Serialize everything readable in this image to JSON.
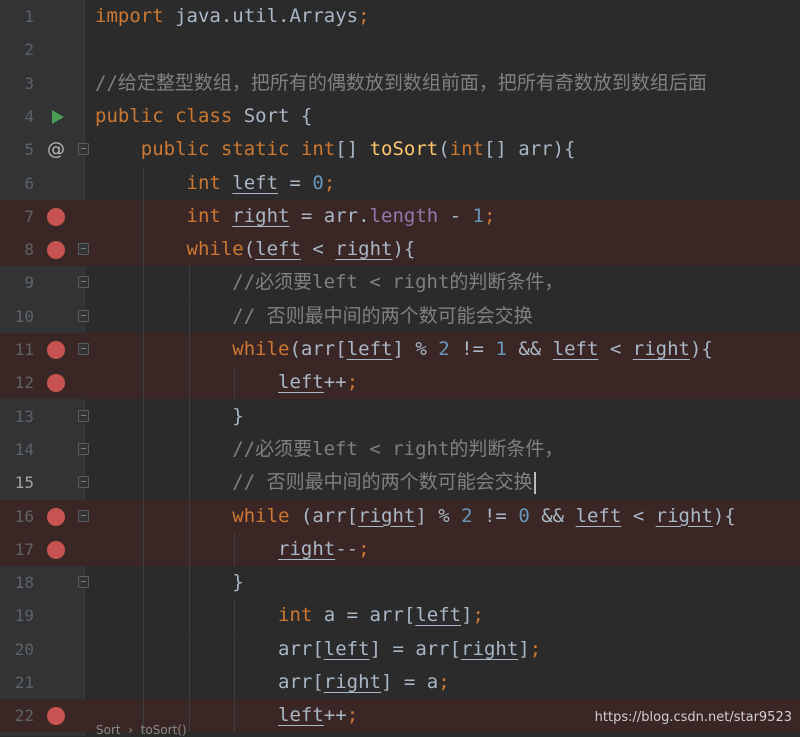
{
  "editor": {
    "lines": [
      {
        "num": "1",
        "marker": "",
        "fold": "",
        "bp_row": false,
        "current": false,
        "indent": 0,
        "tokens": [
          {
            "t": "import",
            "c": "kw"
          },
          {
            "t": " java.util.Arrays",
            "c": ""
          },
          {
            "t": ";",
            "c": "kw"
          }
        ]
      },
      {
        "num": "2",
        "marker": "",
        "fold": "",
        "bp_row": false,
        "current": false,
        "indent": 0,
        "tokens": []
      },
      {
        "num": "3",
        "marker": "",
        "fold": "",
        "bp_row": false,
        "current": false,
        "indent": 0,
        "tokens": [
          {
            "t": "//给定整型数组，把所有的偶数放到数组前面，把所有奇数放到数组后面",
            "c": "cm"
          }
        ]
      },
      {
        "num": "4",
        "marker": "run",
        "fold": "",
        "bp_row": false,
        "current": false,
        "indent": 0,
        "tokens": [
          {
            "t": "public class ",
            "c": "kw"
          },
          {
            "t": "Sort {",
            "c": ""
          }
        ]
      },
      {
        "num": "5",
        "marker": "at",
        "fold": "open",
        "bp_row": false,
        "current": false,
        "indent": 1,
        "tokens": [
          {
            "t": "public static int",
            "c": "kw"
          },
          {
            "t": "[] ",
            "c": ""
          },
          {
            "t": "toSort",
            "c": "fn"
          },
          {
            "t": "(",
            "c": ""
          },
          {
            "t": "int",
            "c": "kw"
          },
          {
            "t": "[] arr){",
            "c": ""
          }
        ]
      },
      {
        "num": "6",
        "marker": "",
        "fold": "",
        "bp_row": false,
        "current": false,
        "indent": 2,
        "tokens": [
          {
            "t": "int ",
            "c": "kw"
          },
          {
            "t": "left",
            "c": "var"
          },
          {
            "t": " = ",
            "c": ""
          },
          {
            "t": "0",
            "c": "num"
          },
          {
            "t": ";",
            "c": "kw"
          }
        ]
      },
      {
        "num": "7",
        "marker": "bp",
        "fold": "",
        "bp_row": true,
        "current": false,
        "indent": 2,
        "tokens": [
          {
            "t": "int ",
            "c": "kw"
          },
          {
            "t": "right",
            "c": "var"
          },
          {
            "t": " = arr.",
            "c": ""
          },
          {
            "t": "length",
            "c": "fld"
          },
          {
            "t": " - ",
            "c": ""
          },
          {
            "t": "1",
            "c": "num"
          },
          {
            "t": ";",
            "c": "kw"
          }
        ]
      },
      {
        "num": "8",
        "marker": "bp",
        "fold": "open",
        "bp_row": true,
        "current": false,
        "indent": 2,
        "tokens": [
          {
            "t": "while",
            "c": "kw"
          },
          {
            "t": "(",
            "c": ""
          },
          {
            "t": "left",
            "c": "var"
          },
          {
            "t": " < ",
            "c": ""
          },
          {
            "t": "right",
            "c": "var"
          },
          {
            "t": "){",
            "c": ""
          }
        ]
      },
      {
        "num": "9",
        "marker": "",
        "fold": "open",
        "bp_row": false,
        "current": false,
        "indent": 3,
        "tokens": [
          {
            "t": "//必须要left < right的判断条件，",
            "c": "cm"
          }
        ]
      },
      {
        "num": "10",
        "marker": "",
        "fold": "close",
        "bp_row": false,
        "current": false,
        "indent": 3,
        "tokens": [
          {
            "t": "// 否则最中间的两个数可能会交换",
            "c": "cm"
          }
        ]
      },
      {
        "num": "11",
        "marker": "bp",
        "fold": "open",
        "bp_row": true,
        "current": false,
        "indent": 3,
        "tokens": [
          {
            "t": "while",
            "c": "kw"
          },
          {
            "t": "(arr[",
            "c": ""
          },
          {
            "t": "left",
            "c": "var"
          },
          {
            "t": "] % ",
            "c": ""
          },
          {
            "t": "2",
            "c": "num"
          },
          {
            "t": " != ",
            "c": ""
          },
          {
            "t": "1",
            "c": "num"
          },
          {
            "t": " && ",
            "c": ""
          },
          {
            "t": "left",
            "c": "var"
          },
          {
            "t": " < ",
            "c": ""
          },
          {
            "t": "right",
            "c": "var"
          },
          {
            "t": "){",
            "c": ""
          }
        ]
      },
      {
        "num": "12",
        "marker": "bp",
        "fold": "",
        "bp_row": true,
        "current": false,
        "indent": 4,
        "tokens": [
          {
            "t": "left",
            "c": "var"
          },
          {
            "t": "++",
            "c": ""
          },
          {
            "t": ";",
            "c": "kw"
          }
        ]
      },
      {
        "num": "13",
        "marker": "",
        "fold": "close",
        "bp_row": false,
        "current": false,
        "indent": 3,
        "tokens": [
          {
            "t": "}",
            "c": ""
          }
        ]
      },
      {
        "num": "14",
        "marker": "",
        "fold": "open",
        "bp_row": false,
        "current": false,
        "indent": 3,
        "tokens": [
          {
            "t": "//必须要left < right的判断条件，",
            "c": "cm"
          }
        ]
      },
      {
        "num": "15",
        "marker": "",
        "fold": "close",
        "bp_row": false,
        "current": true,
        "indent": 3,
        "tokens": [
          {
            "t": "// 否则最中间的两个数可能会交换",
            "c": "cm"
          }
        ],
        "caret": true
      },
      {
        "num": "16",
        "marker": "bp",
        "fold": "open",
        "bp_row": true,
        "current": false,
        "indent": 3,
        "tokens": [
          {
            "t": "while",
            "c": "kw"
          },
          {
            "t": " (arr[",
            "c": ""
          },
          {
            "t": "right",
            "c": "var"
          },
          {
            "t": "] % ",
            "c": ""
          },
          {
            "t": "2",
            "c": "num"
          },
          {
            "t": " != ",
            "c": ""
          },
          {
            "t": "0",
            "c": "num"
          },
          {
            "t": " && ",
            "c": ""
          },
          {
            "t": "left",
            "c": "var"
          },
          {
            "t": " < ",
            "c": ""
          },
          {
            "t": "right",
            "c": "var"
          },
          {
            "t": "){",
            "c": ""
          }
        ]
      },
      {
        "num": "17",
        "marker": "bp",
        "fold": "",
        "bp_row": true,
        "current": false,
        "indent": 4,
        "tokens": [
          {
            "t": "right",
            "c": "var"
          },
          {
            "t": "--",
            "c": ""
          },
          {
            "t": ";",
            "c": "kw"
          }
        ]
      },
      {
        "num": "18",
        "marker": "",
        "fold": "close",
        "bp_row": false,
        "current": false,
        "indent": 3,
        "tokens": [
          {
            "t": "}",
            "c": ""
          }
        ]
      },
      {
        "num": "19",
        "marker": "",
        "fold": "",
        "bp_row": false,
        "current": false,
        "indent": 4,
        "tokens": [
          {
            "t": "int ",
            "c": "kw"
          },
          {
            "t": "a = arr[",
            "c": ""
          },
          {
            "t": "left",
            "c": "var"
          },
          {
            "t": "]",
            "c": ""
          },
          {
            "t": ";",
            "c": "kw"
          }
        ]
      },
      {
        "num": "20",
        "marker": "",
        "fold": "",
        "bp_row": false,
        "current": false,
        "indent": 4,
        "tokens": [
          {
            "t": "arr[",
            "c": ""
          },
          {
            "t": "left",
            "c": "var"
          },
          {
            "t": "] = arr[",
            "c": ""
          },
          {
            "t": "right",
            "c": "var"
          },
          {
            "t": "]",
            "c": ""
          },
          {
            "t": ";",
            "c": "kw"
          }
        ]
      },
      {
        "num": "21",
        "marker": "",
        "fold": "",
        "bp_row": false,
        "current": false,
        "indent": 4,
        "tokens": [
          {
            "t": "arr[",
            "c": ""
          },
          {
            "t": "right",
            "c": "var"
          },
          {
            "t": "] = a",
            "c": ""
          },
          {
            "t": ";",
            "c": "kw"
          }
        ]
      },
      {
        "num": "22",
        "marker": "bp",
        "fold": "",
        "bp_row": true,
        "current": false,
        "indent": 4,
        "tokens": [
          {
            "t": "left",
            "c": "var"
          },
          {
            "t": "++",
            "c": ""
          },
          {
            "t": ";",
            "c": "kw"
          }
        ]
      }
    ]
  },
  "breadcrumbs": {
    "text": "Sort  ›  toSort()"
  },
  "watermark": {
    "text": "https://blog.csdn.net/star9523"
  },
  "colors": {
    "background": "#2b2b2b",
    "gutter": "#313335",
    "breakpoint": "#c75450",
    "breakpoint_row": "#3b2626",
    "keyword": "#cc7832",
    "method": "#ffc66d",
    "number": "#6897bb",
    "comment": "#808080",
    "field": "#9876aa",
    "text": "#a9b7c6"
  }
}
